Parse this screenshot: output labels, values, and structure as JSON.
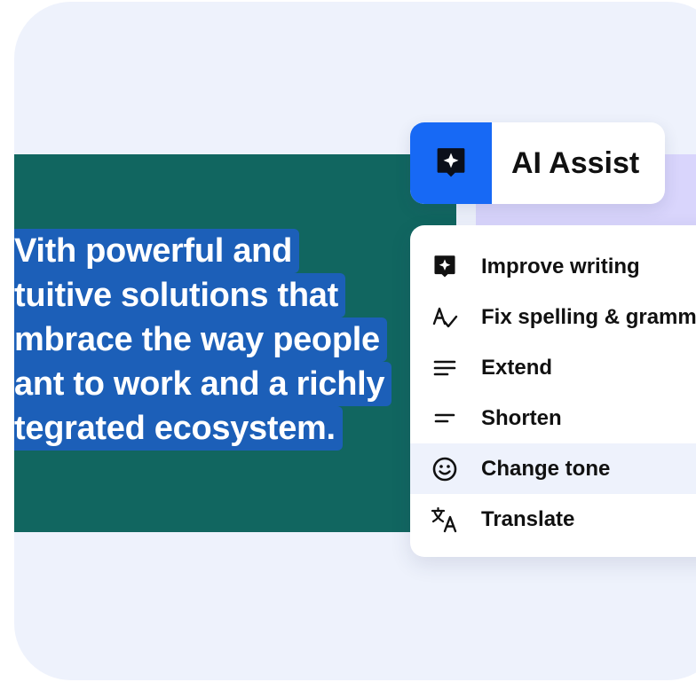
{
  "editor": {
    "lines": [
      "Vith powerful and",
      "tuitive solutions that",
      "mbrace the way people",
      "ant to work and a richly",
      "tegrated ecosystem."
    ]
  },
  "ai_assist": {
    "label": "AI Assist",
    "icon": "sparkle-bubble-icon"
  },
  "menu": {
    "items": [
      {
        "label": "Improve writing",
        "icon": "sparkle-bubble-icon"
      },
      {
        "label": "Fix spelling & grammar",
        "icon": "spell-check-icon"
      },
      {
        "label": "Extend",
        "icon": "extend-lines-icon"
      },
      {
        "label": "Shorten",
        "icon": "shorten-lines-icon"
      },
      {
        "label": "Change tone",
        "icon": "smiley-icon"
      },
      {
        "label": "Translate",
        "icon": "translate-icon"
      }
    ],
    "active_index": 4
  },
  "colors": {
    "accent": "#1769f5",
    "editor_bg": "#116660",
    "highlight": "#1c5fb8",
    "card_bg": "#eef2fc"
  }
}
